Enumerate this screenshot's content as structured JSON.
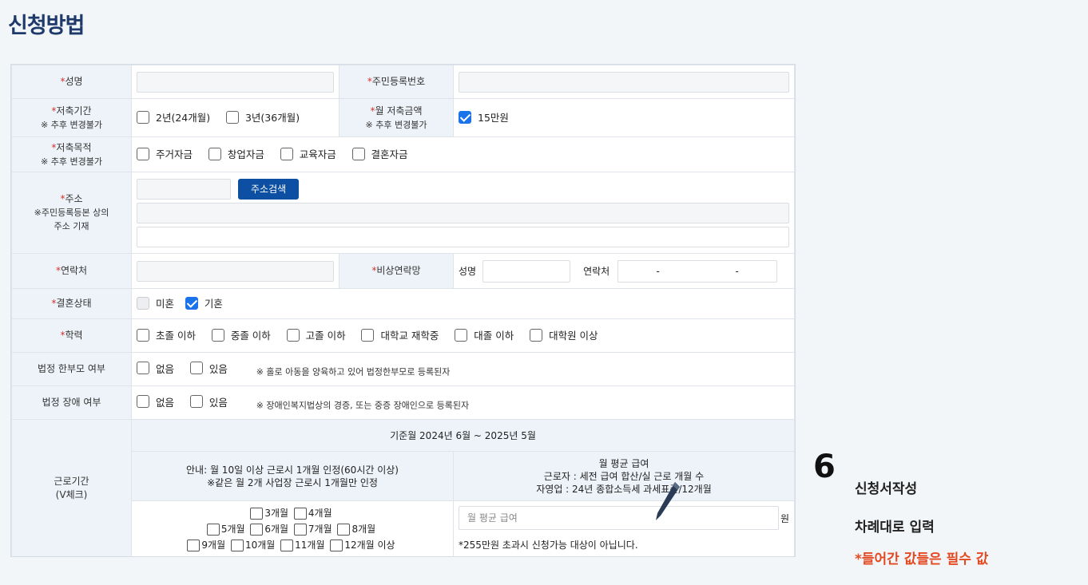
{
  "page_title": "신청방법",
  "form": {
    "name_label": "성명",
    "rrn_label": "주민등록번호",
    "period_label": "저축기간",
    "period_sub": "※ 추후 변경불가",
    "period_opts": [
      "2년(24개월)",
      "3년(36개월)"
    ],
    "monthly_label": "월 저축금액",
    "monthly_sub": "※ 추후 변경불가",
    "monthly_opt": "15만원",
    "purpose_label": "저축목적",
    "purpose_sub": "※ 추후 변경불가",
    "purpose_opts": [
      "주거자금",
      "창업자금",
      "교육자금",
      "결혼자금"
    ],
    "address_label": "주소",
    "address_sub1": "※주민등록등본 상의",
    "address_sub2": "주소 기재",
    "address_btn": "주소검색",
    "contact_label": "연락처",
    "emergency_label": "비상연락망",
    "emergency_name": "성명",
    "emergency_phone": "연락처",
    "dash": "-",
    "marital_label": "결혼상태",
    "marital_opts": [
      "미혼",
      "기혼"
    ],
    "education_label": "학력",
    "education_opts": [
      "초졸 이하",
      "중졸 이하",
      "고졸 이하",
      "대학교 재학중",
      "대졸 이하",
      "대학원 이상"
    ],
    "single_parent_label": "법정 한부모 여부",
    "single_parent_opts": [
      "없음",
      "있음"
    ],
    "single_parent_note": "※ 홀로 아동을 양육하고 있어 법정한부모로 등록된자",
    "disability_label": "법정 장애 여부",
    "disability_opts": [
      "없음",
      "있음"
    ],
    "disability_note": "※ 장애인복지법상의 경증, 또는 중증 장애인으로 등록된자",
    "work_label": "근로기간",
    "work_sub": "(V체크)",
    "base_month": "기준월 2024년 6월 ~ 2025년 5월",
    "guide1": "안내: 월 10일 이상 근로시 1개월 인정(60시간 이상)",
    "guide2": "※같은 월 2개 사업장 근로시 1개월만 인정",
    "salary_title": "월 평균 급여",
    "salary_l1": "근로자 : 세전 급여 합산/실 근로 개월 수",
    "salary_l2": "자영업 : 24년 종합소득세 과세표준/12개월",
    "months_row1": [
      "3개월",
      "4개월"
    ],
    "months_row2": [
      "5개월",
      "6개월",
      "7개월",
      "8개월"
    ],
    "months_row3": [
      "9개월",
      "10개월",
      "11개월",
      "12개월 이상"
    ],
    "salary_placeholder": "월 평균 급여",
    "won": "원",
    "salary_note": "*255만원 초과시 신청가능 대상이 아닙니다."
  },
  "side": {
    "step": "6",
    "line1": "신청서작성",
    "line2": "차례대로 입력",
    "line3": "*들어간 값들은 필수 값"
  },
  "colors": {
    "title": "#1e3a6b",
    "accent": "#0d4fa3",
    "check": "#1a73e8",
    "warn": "#e44a22"
  }
}
